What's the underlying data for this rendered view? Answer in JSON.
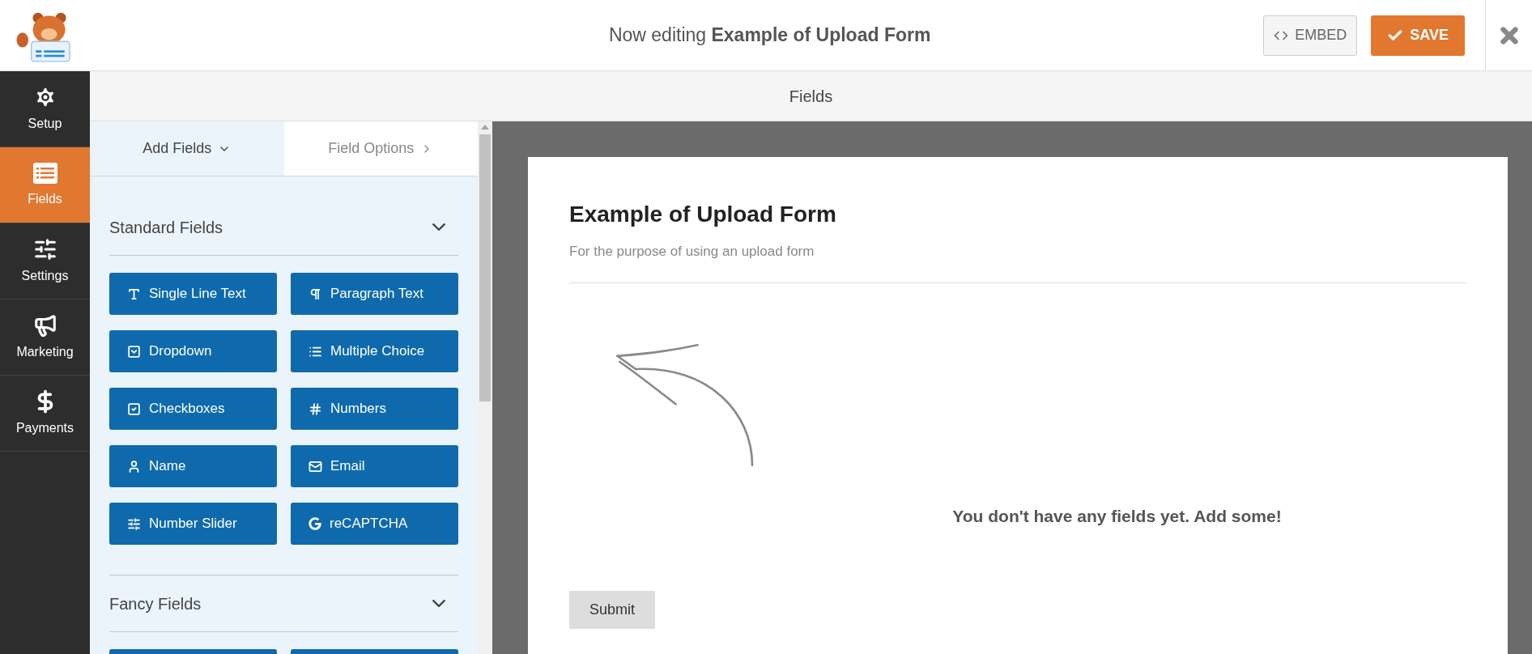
{
  "header": {
    "title": "Now editing **Example of Upload Form**",
    "embed_button": "EMBED",
    "save_button": "SAVE"
  },
  "sidebar": {
    "items": [
      {
        "label": "Setup",
        "selected": false
      },
      {
        "label": "Fields",
        "selected": true
      },
      {
        "label": "Settings",
        "selected": false
      },
      {
        "label": "Marketing",
        "selected": false
      },
      {
        "label": "Payments",
        "selected": false
      }
    ]
  },
  "toolbar": {
    "title": "Fields"
  },
  "panel": {
    "tabs": [
      {
        "label": "Add Fields",
        "selected": true
      },
      {
        "label": "Field Options",
        "selected": false
      }
    ],
    "sections": [
      {
        "title": "Standard Fields",
        "expanded": true,
        "fields": [
          "Single Line Text",
          "Paragraph Text",
          "Dropdown",
          "Multiple Choice",
          "Checkboxes",
          "Numbers",
          "Name",
          "Email",
          "Number Slider",
          "reCAPTCHA"
        ]
      },
      {
        "title": "Fancy Fields",
        "expanded": true
      }
    ]
  },
  "form": {
    "title": "Example of Upload Form",
    "description": "For the purpose of using an upload form",
    "empty_message": "You don't have any fields yet. Add some!",
    "submit_button": "Submit"
  }
}
